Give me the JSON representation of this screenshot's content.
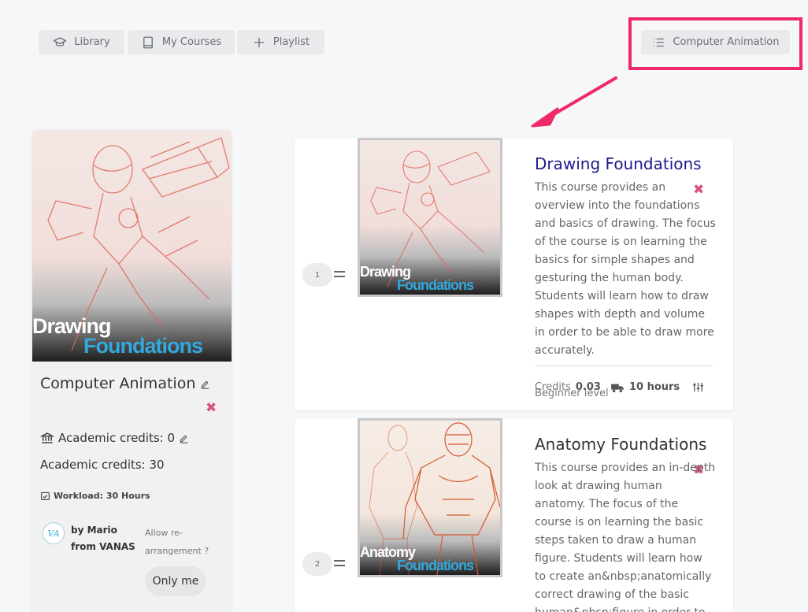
{
  "nav": {
    "library": "Library",
    "my_courses": "My Courses",
    "playlist": "Playlist",
    "playlist_select": "Computer Animation"
  },
  "playlist": {
    "cover": {
      "word1": "Drawing",
      "word2": "Foundations"
    },
    "title": "Computer Animation",
    "academic_credits_label": "Academic credits: 0",
    "academic_credits_total": "Academic credits: 30",
    "workload": "Workload: 30 Hours",
    "avatar_text": "VA",
    "author": "by Mario from VANAS",
    "allow_rearrange": "Allow re-arrangement ?",
    "only_me": "Only me"
  },
  "courses": [
    {
      "number": "1",
      "thumb_word1": "Drawing",
      "thumb_word2": "Foundations",
      "title": "Drawing Foundations",
      "description": "This course provides an overview into the foundations and basics of drawing. The focus of the course is on learning the basics for simple shapes and gesturing the human body. Students will learn how to draw shapes with depth and volume in order to be able to draw more accurately.",
      "credits_label": "Credits",
      "credits_value": "0.03",
      "hours": "10 hours",
      "level": "Beginner level"
    },
    {
      "number": "2",
      "thumb_word1": "Anatomy",
      "thumb_word2": "Foundations",
      "title": "Anatomy Foundations",
      "description": "This course provides an in-depth look at drawing human anatomy. The focus of the course is on learning the basic steps taken to draw a human figure. Students will learn how to create an&nbsp;anatomically correct drawing of the basic human&nbsp;figure in order to"
    }
  ],
  "colors": {
    "highlight": "#ef2866",
    "title_link": "#1a1a8c",
    "remove_x": "#d9537f",
    "foundations_blue": "#34a8dc"
  }
}
